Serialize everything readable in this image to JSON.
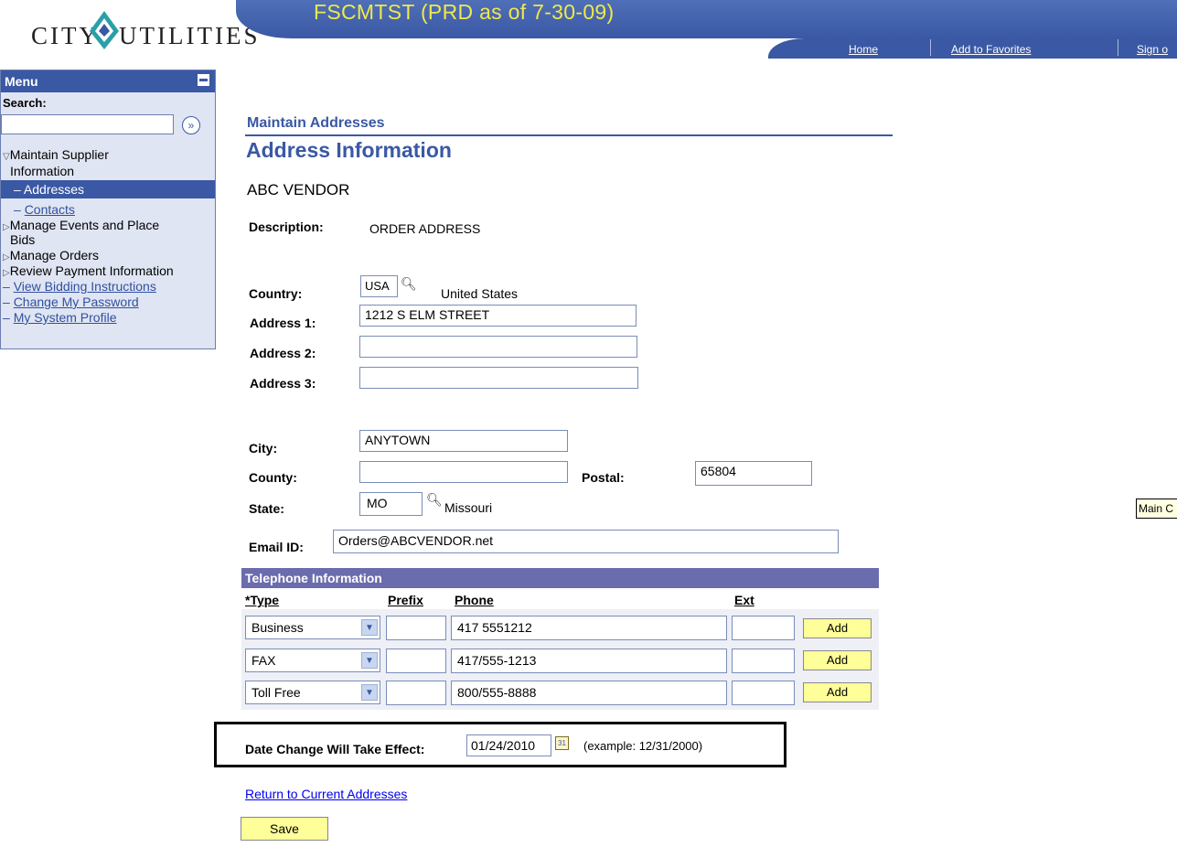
{
  "header": {
    "logo_text_left": "CITY",
    "logo_text_right": "UTILITIES",
    "environment_title": "FSCMTST (PRD as of 7-30-09)",
    "nav": [
      "Home",
      "Add to Favorites",
      "Sign o"
    ],
    "tooltip": "Main C"
  },
  "menu": {
    "title": "Menu",
    "search_label": "Search:",
    "search_go": "»",
    "items": [
      {
        "label": "Maintain Supplier",
        "marker": "▽"
      },
      {
        "label": "Information"
      },
      {
        "label": "– Addresses"
      },
      {
        "label": "– Contacts"
      },
      {
        "label": "Manage Events and Place",
        "marker": "▷"
      },
      {
        "label": "Bids"
      },
      {
        "label": "Manage Orders",
        "marker": "▷"
      },
      {
        "label": "Review Payment Information",
        "marker": "▷"
      },
      {
        "label": "View Bidding Instructions"
      },
      {
        "label": "Change My Password"
      },
      {
        "label": "My System Profile"
      }
    ]
  },
  "page": {
    "breadcrumb": "Maintain Addresses",
    "title": "Address Information",
    "vendor": "ABC VENDOR",
    "description_label": "Description:",
    "description_value": "ORDER ADDRESS"
  },
  "address": {
    "country_label": "Country:",
    "country_code": "USA",
    "country_name": "United States",
    "address1_label": "Address 1:",
    "address1": "1212 S ELM STREET",
    "address2_label": "Address 2:",
    "address2": "",
    "address3_label": "Address 3:",
    "address3": "",
    "city_label": "City:",
    "city": "ANYTOWN",
    "county_label": "County:",
    "county": "",
    "postal_label": "Postal:",
    "postal": "65804",
    "state_label": "State:",
    "state_code": "MO",
    "state_name": "Missouri",
    "email_label": "Email ID:",
    "email": "Orders@ABCVENDOR.net"
  },
  "telephone": {
    "section_title": "Telephone Information",
    "col_type": "*Type",
    "col_prefix": "Prefix",
    "col_phone": "Phone",
    "col_ext": "Ext",
    "add_label": "Add",
    "rows": [
      {
        "type": "Business",
        "prefix": "",
        "phone": "417 5551212",
        "ext": ""
      },
      {
        "type": "FAX",
        "prefix": "",
        "phone": "417/555-1213",
        "ext": ""
      },
      {
        "type": "Toll Free",
        "prefix": "",
        "phone": "800/555-8888",
        "ext": ""
      }
    ]
  },
  "effective": {
    "label": "Date Change Will Take Effect:",
    "value": "01/24/2010",
    "example": "(example: 12/31/2000)"
  },
  "footer": {
    "return_link": "Return to Current Addresses",
    "save_label": "Save"
  },
  "colors": {
    "brand_blue": "#3a58a4",
    "title_yellow": "#f0e84a",
    "button_yellow": "#ffff99",
    "link_blue": "#0000ee"
  }
}
